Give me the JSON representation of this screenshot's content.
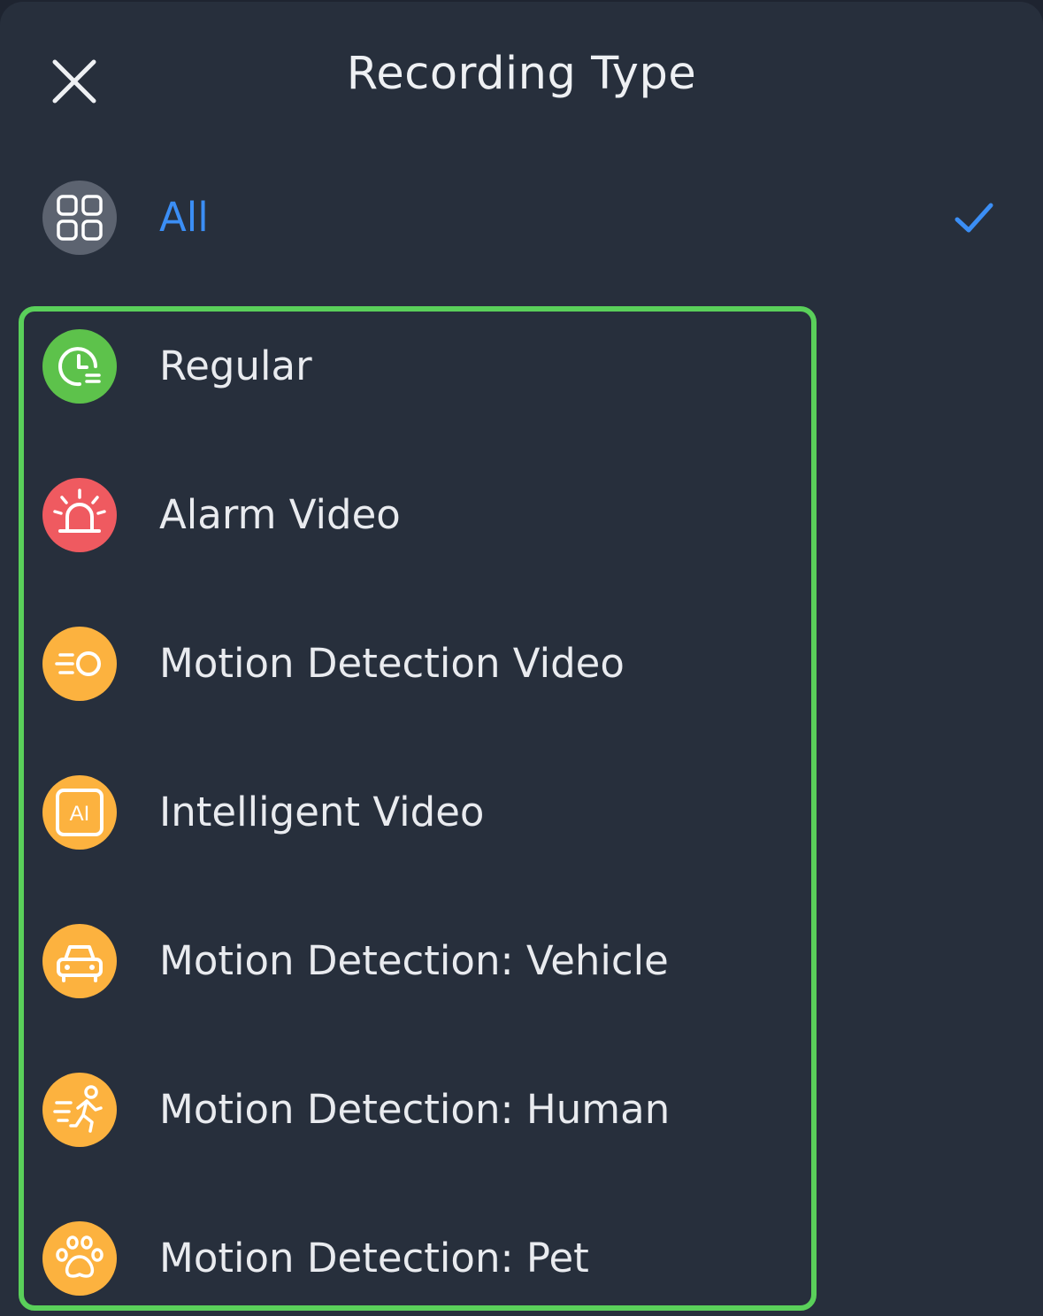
{
  "header": {
    "title": "Recording Type",
    "close_icon": "close-icon"
  },
  "colors": {
    "background": "#272f3c",
    "selected_text": "#3b8ef5",
    "check": "#3b8ef5",
    "highlight_border": "#5ad05a",
    "icon_all": "#5c6370",
    "icon_regular": "#5dc24b",
    "icon_alarm": "#ef5a60",
    "icon_motion": "#fcb23f"
  },
  "options": [
    {
      "label": "All",
      "icon": "grid-icon",
      "selected": true
    },
    {
      "label": "Regular",
      "icon": "clock-list-icon",
      "selected": false
    },
    {
      "label": "Alarm Video",
      "icon": "siren-icon",
      "selected": false
    },
    {
      "label": "Motion Detection Video",
      "icon": "motion-icon",
      "selected": false
    },
    {
      "label": "Intelligent Video",
      "icon": "ai-icon",
      "selected": false
    },
    {
      "label": "Motion Detection: Vehicle",
      "icon": "car-icon",
      "selected": false
    },
    {
      "label": "Motion Detection: Human",
      "icon": "running-person-icon",
      "selected": false
    },
    {
      "label": "Motion Detection: Pet",
      "icon": "paw-icon",
      "selected": false
    }
  ]
}
